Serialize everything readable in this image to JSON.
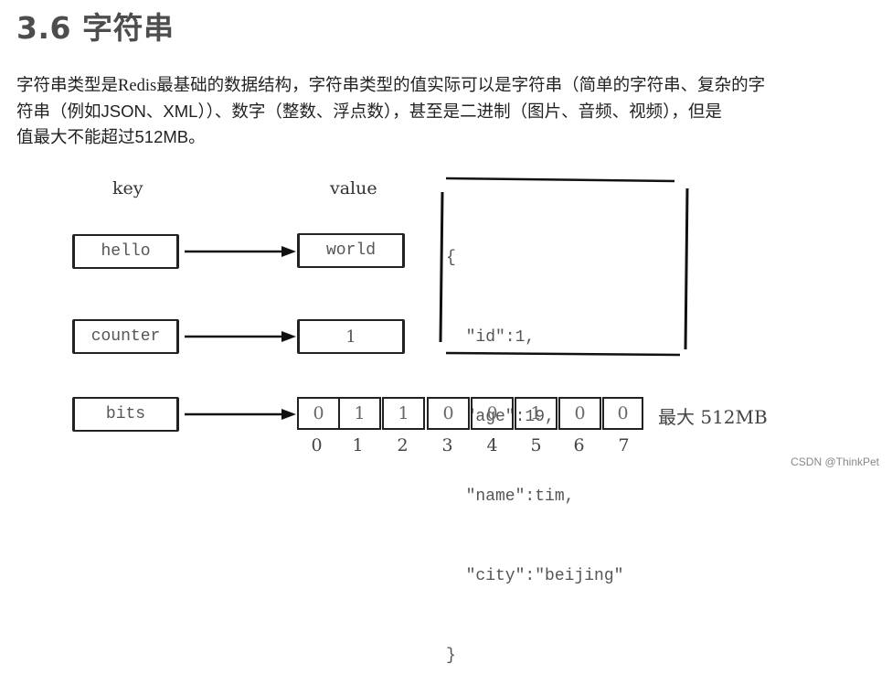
{
  "heading": "3.6 字符串",
  "paragraph": {
    "line1_a": "字符串类型是",
    "line1_b": "Redis",
    "line1_c": "最基础的数据结构，字符串类型的值实际可以是字符串（简单的字符串、复杂的字",
    "line2_a": "符串（例如",
    "line2_b": "JSON、XML",
    "line2_c": "））、数字（整数、浮点数），甚至是二进制（图片、音频、视频），但是",
    "line3_a": "值最大不能超过",
    "line3_b": "512MB",
    "line3_c": "。"
  },
  "diagram": {
    "key_header": "key",
    "value_header": "value",
    "rows": [
      {
        "key": "hello",
        "value": "world"
      },
      {
        "key": "counter",
        "value": "1"
      },
      {
        "key": "bits"
      }
    ],
    "json_lines": [
      "{",
      "  \"id\":1,",
      "  \"age\":19,",
      "  \"name\":tim,",
      "  \"city\":\"beijing\"",
      "}"
    ],
    "bits": [
      "0",
      "1",
      "1",
      "0",
      "0",
      "1",
      "0",
      "0"
    ],
    "bit_indices": [
      "0",
      "1",
      "2",
      "3",
      "4",
      "5",
      "6",
      "7"
    ],
    "max_label": "最大 512MB"
  },
  "watermark": "CSDN @ThinkPet"
}
